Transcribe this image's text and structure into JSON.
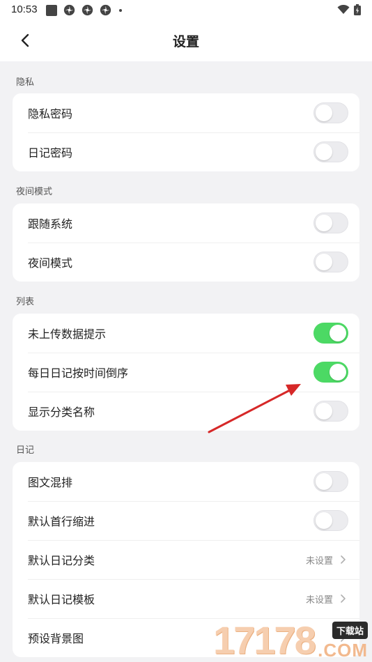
{
  "status_bar": {
    "time": "10:53"
  },
  "header": {
    "title": "设置"
  },
  "sections": [
    {
      "title": "隐私",
      "items": [
        {
          "label": "隐私密码",
          "type": "toggle",
          "on": false
        },
        {
          "label": "日记密码",
          "type": "toggle",
          "on": false
        }
      ]
    },
    {
      "title": "夜间模式",
      "items": [
        {
          "label": "跟随系统",
          "type": "toggle",
          "on": false
        },
        {
          "label": "夜间模式",
          "type": "toggle",
          "on": false
        }
      ]
    },
    {
      "title": "列表",
      "items": [
        {
          "label": "未上传数据提示",
          "type": "toggle",
          "on": true
        },
        {
          "label": "每日日记按时间倒序",
          "type": "toggle",
          "on": true
        },
        {
          "label": "显示分类名称",
          "type": "toggle",
          "on": false
        }
      ]
    },
    {
      "title": "日记",
      "items": [
        {
          "label": "图文混排",
          "type": "toggle",
          "on": false
        },
        {
          "label": "默认首行缩进",
          "type": "toggle",
          "on": false
        },
        {
          "label": "默认日记分类",
          "type": "link",
          "value": "未设置"
        },
        {
          "label": "默认日记模板",
          "type": "link",
          "value": "未设置"
        },
        {
          "label": "预设背景图",
          "type": "link",
          "value": ""
        }
      ]
    }
  ],
  "watermark": {
    "number": "17178",
    "badge": "下载站",
    "domain": ".COM"
  },
  "colors": {
    "toggle_on": "#4cd964",
    "toggle_off": "#ececef",
    "annotation_arrow": "#d62828"
  }
}
